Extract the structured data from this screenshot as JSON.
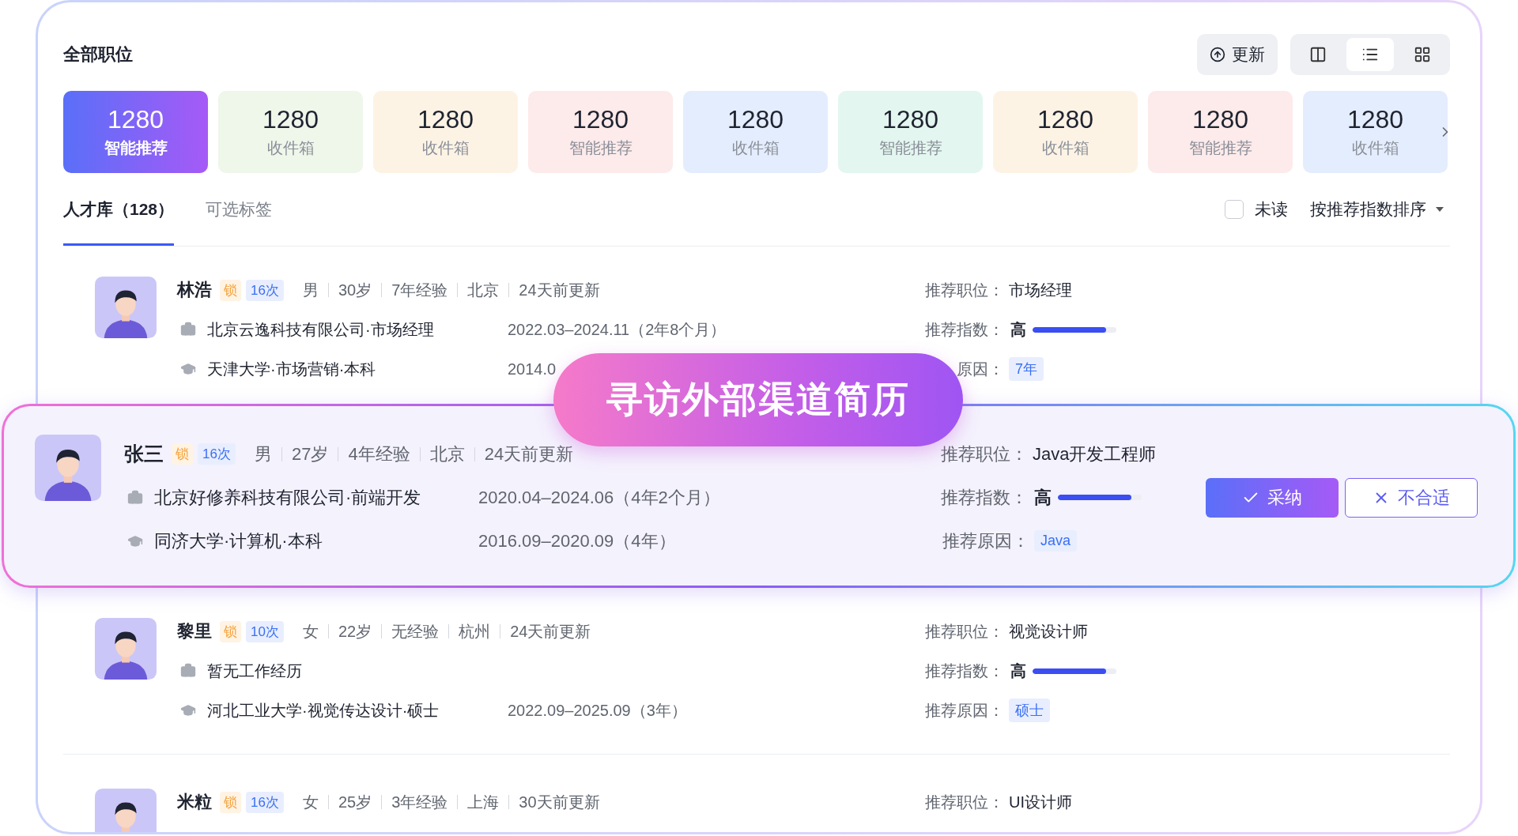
{
  "header": {
    "title": "全部职位",
    "update_button": "更新",
    "views": [
      {
        "kind": "columns",
        "selected": false
      },
      {
        "kind": "list",
        "selected": true
      },
      {
        "kind": "grid",
        "selected": false
      }
    ]
  },
  "cards": [
    {
      "count": "1280",
      "label": "智能推荐",
      "selected": true
    },
    {
      "count": "1280",
      "label": "收件箱",
      "selected": false,
      "color": "#eff6ea"
    },
    {
      "count": "1280",
      "label": "收件箱",
      "selected": false,
      "color": "#fdf3e5"
    },
    {
      "count": "1280",
      "label": "智能推荐",
      "selected": false,
      "color": "#fdeaea"
    },
    {
      "count": "1280",
      "label": "收件箱",
      "selected": false,
      "color": "#e4edfd"
    },
    {
      "count": "1280",
      "label": "智能推荐",
      "selected": false,
      "color": "#e3f6ef"
    },
    {
      "count": "1280",
      "label": "收件箱",
      "selected": false,
      "color": "#fdf3e5"
    },
    {
      "count": "1280",
      "label": "智能推荐",
      "selected": false,
      "color": "#fdeaea"
    },
    {
      "count": "1280",
      "label": "收件箱",
      "selected": false,
      "color": "#e4edfd"
    }
  ],
  "tabs": [
    {
      "label": "人才库（128）",
      "selected": true
    },
    {
      "label": "可选标签",
      "selected": false
    }
  ],
  "unread_filter": {
    "label": "未读",
    "checked": false
  },
  "sort": "按推荐指数排序",
  "banner": "寻访外部渠道简历",
  "candidates": [
    {
      "name": "林浩",
      "lock": "锁",
      "count": "16次",
      "highlighted": false,
      "facts": [
        "男",
        "30岁",
        "7年经验",
        "北京",
        "24天前更新"
      ],
      "job": "北京云逸科技有限公司·市场经理",
      "job_period": "2022.03–2024.11（2年8个月）",
      "edu": "天津大学·市场营销·本科",
      "edu_period": "2014.0",
      "rec_job_label": "推荐职位：",
      "rec_job": "市场经理",
      "score_label": "推荐指数：",
      "score": "高",
      "level": 0.88,
      "reason_label": "原因：",
      "reason": "7年"
    },
    {
      "name": "张三",
      "lock": "锁",
      "count": "16次",
      "highlighted": true,
      "facts": [
        "男",
        "27岁",
        "4年经验",
        "北京",
        "24天前更新"
      ],
      "job": "北京好修养科技有限公司·前端开发",
      "job_period": "2020.04–2024.06（4年2个月）",
      "edu": "同济大学·计算机·本科",
      "edu_period": "2016.09–2020.09（4年）",
      "rec_job_label": "推荐职位：",
      "rec_job": "Java开发工程师",
      "score_label": "推荐指数：",
      "score": "高",
      "level": 0.88,
      "reason_label": "推荐原因：",
      "reason": "Java",
      "accept": "采纳",
      "reject": "不合适"
    },
    {
      "name": "黎里",
      "lock": "锁",
      "count": "10次",
      "highlighted": false,
      "facts": [
        "女",
        "22岁",
        "无经验",
        "杭州",
        "24天前更新"
      ],
      "job": "暂无工作经历",
      "edu": "河北工业大学·视觉传达设计·硕士",
      "edu_period": "2022.09–2025.09（3年）",
      "rec_job_label": "推荐职位：",
      "rec_job": "视觉设计师",
      "score_label": "推荐指数：",
      "score": "高",
      "level": 0.88,
      "reason_label": "推荐原因：",
      "reason": "硕士"
    },
    {
      "name": "米粒",
      "lock": "锁",
      "count": "16次",
      "highlighted": false,
      "facts": [
        "女",
        "25岁",
        "3年经验",
        "上海",
        "30天前更新"
      ],
      "rec_job_label": "推荐职位：",
      "rec_job": "UI设计师"
    }
  ]
}
